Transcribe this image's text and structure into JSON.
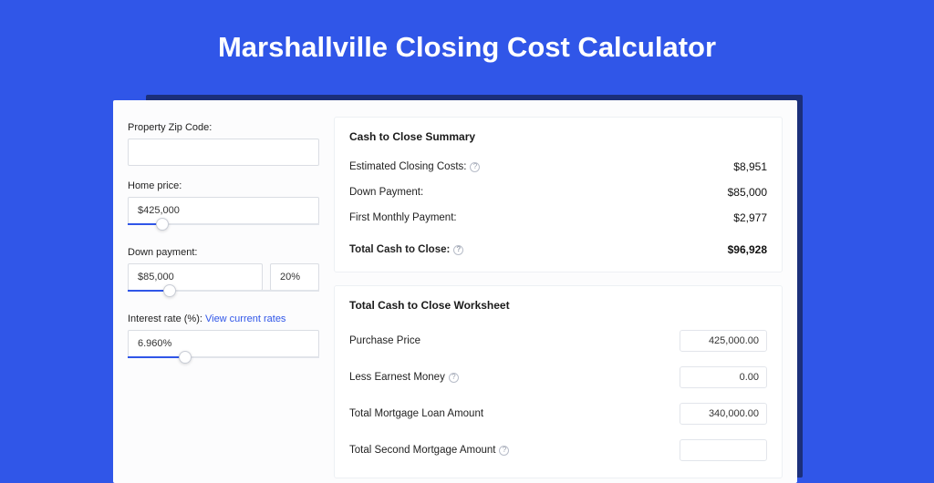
{
  "title": "Marshallville Closing Cost Calculator",
  "left": {
    "zip_label": "Property Zip Code:",
    "zip_value": "",
    "home_price_label": "Home price:",
    "home_price_value": "$425,000",
    "home_price_slider_pct": 18,
    "down_payment_label": "Down payment:",
    "down_payment_value": "$85,000",
    "down_payment_pct_value": "20%",
    "down_payment_slider_pct": 22,
    "rate_label": "Interest rate (%):",
    "rate_link": "View current rates",
    "rate_value": "6.960%",
    "rate_slider_pct": 30
  },
  "summary": {
    "heading": "Cash to Close Summary",
    "rows": [
      {
        "label": "Estimated Closing Costs:",
        "help": true,
        "value": "$8,951"
      },
      {
        "label": "Down Payment:",
        "help": false,
        "value": "$85,000"
      },
      {
        "label": "First Monthly Payment:",
        "help": false,
        "value": "$2,977"
      }
    ],
    "total_label": "Total Cash to Close:",
    "total_value": "$96,928"
  },
  "worksheet": {
    "heading": "Total Cash to Close Worksheet",
    "rows": [
      {
        "label": "Purchase Price",
        "help": false,
        "value": "425,000.00"
      },
      {
        "label": "Less Earnest Money",
        "help": true,
        "value": "0.00"
      },
      {
        "label": "Total Mortgage Loan Amount",
        "help": false,
        "value": "340,000.00"
      },
      {
        "label": "Total Second Mortgage Amount",
        "help": true,
        "value": ""
      }
    ]
  }
}
